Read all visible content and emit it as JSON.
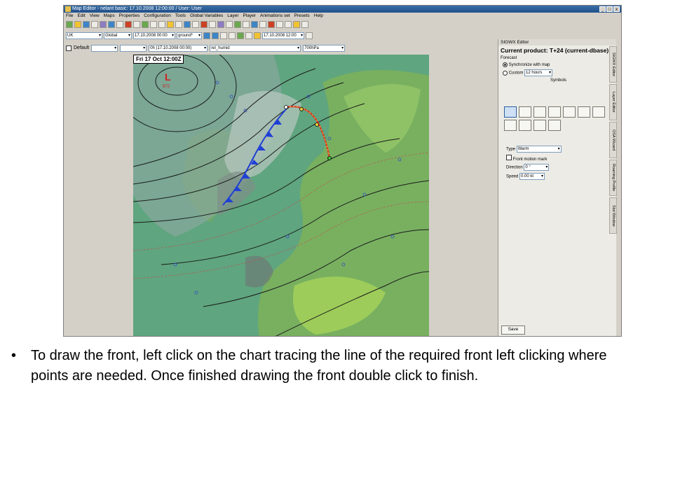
{
  "window": {
    "title": "Map Editor - nelant basic: 17.10.2008 12:00:00 / User: User",
    "controls": [
      "_",
      "□",
      "x"
    ]
  },
  "menu": [
    "File",
    "Edit",
    "View",
    "Maps",
    "Properties",
    "Configuration",
    "Tools",
    "Global Variables",
    "Layer",
    "Player",
    "Animations set",
    "Presets",
    "Help"
  ],
  "toolbar2": {
    "area_primary": "UK",
    "area_secondary": "Global",
    "datetime": "17.10.2008 00:00",
    "level": "ground*",
    "datetime2": "17.10.2008 12:00"
  },
  "fieldrow": {
    "default_label": "Default",
    "forecast": "0h (17.10.2008 00:00)",
    "parameter": "rel_humid",
    "level": "700hPa"
  },
  "map": {
    "valid_time": "Fri 17 Oct 12:00Z",
    "low_letter": "L",
    "low_value": "972"
  },
  "panel": {
    "title": "SIGWX Editor",
    "product": "Current product: T+24 (current-dbase)",
    "forecast_label": "Forecast",
    "sync_label": "Synchronize with map",
    "custom_label": "Custom",
    "custom_value": "12 hours",
    "symbols_label": "Symbols",
    "type_label": "Type",
    "type_value": "Warm",
    "motion_label": "Front motion mark",
    "direction_label": "Direction",
    "direction_value": "0 °",
    "speed_label": "Speed",
    "speed_value": "0.00 kt",
    "save_label": "Save",
    "tabs": [
      "SIGWX Editor",
      "Layer Editor",
      "OSA Wizard",
      "Roaming Profile",
      "Slot Window"
    ]
  },
  "caption": "To draw the front, left click on the chart tracing the line of the required front left clicking where points are needed. Once finished drawing the front double click to finish.",
  "colors": {
    "map_sea": "#5fa57f",
    "cold_front": "#1f3fd6",
    "warm_front": "#e03020",
    "titlebar": "#2a5d99"
  }
}
